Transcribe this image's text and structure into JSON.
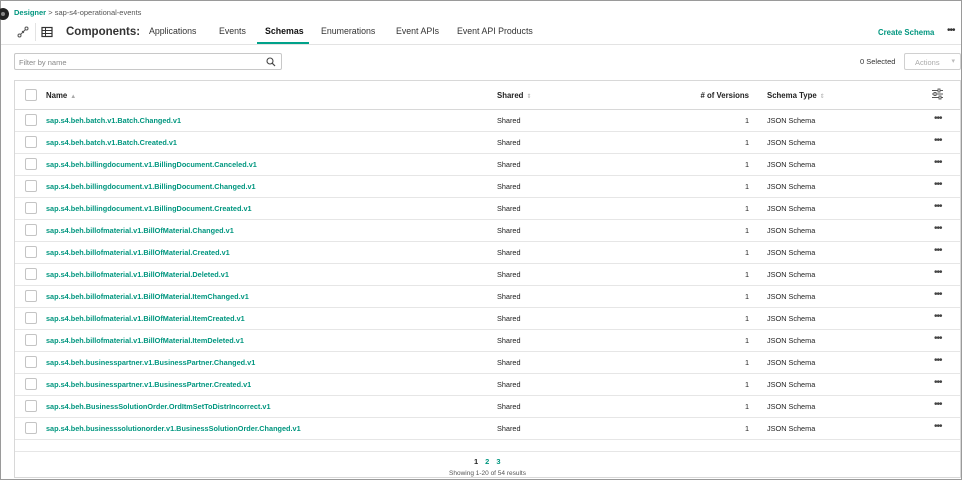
{
  "breadcrumb": {
    "root": "Designer",
    "separator": ">",
    "current": "sap-s4-operational-events"
  },
  "header": {
    "components_label": "Components:",
    "tabs": [
      {
        "label": "Applications",
        "active": false
      },
      {
        "label": "Events",
        "active": false
      },
      {
        "label": "Schemas",
        "active": true
      },
      {
        "label": "Enumerations",
        "active": false
      },
      {
        "label": "Event APIs",
        "active": false
      },
      {
        "label": "Event API Products",
        "active": false
      }
    ],
    "create_label": "Create Schema",
    "more_label": "•••"
  },
  "toolbar": {
    "filter_placeholder": "Filter by name",
    "filter_value": "",
    "selected_text": "0 Selected",
    "actions_label": "Actions"
  },
  "table": {
    "columns": {
      "name": "Name",
      "shared": "Shared",
      "versions": "# of Versions",
      "type": "Schema Type"
    },
    "rows": [
      {
        "name": "sap.s4.beh.batch.v1.Batch.Changed.v1",
        "shared": "Shared",
        "versions": "1",
        "type": "JSON Schema"
      },
      {
        "name": "sap.s4.beh.batch.v1.Batch.Created.v1",
        "shared": "Shared",
        "versions": "1",
        "type": "JSON Schema"
      },
      {
        "name": "sap.s4.beh.billingdocument.v1.BillingDocument.Canceled.v1",
        "shared": "Shared",
        "versions": "1",
        "type": "JSON Schema"
      },
      {
        "name": "sap.s4.beh.billingdocument.v1.BillingDocument.Changed.v1",
        "shared": "Shared",
        "versions": "1",
        "type": "JSON Schema"
      },
      {
        "name": "sap.s4.beh.billingdocument.v1.BillingDocument.Created.v1",
        "shared": "Shared",
        "versions": "1",
        "type": "JSON Schema"
      },
      {
        "name": "sap.s4.beh.billofmaterial.v1.BillOfMaterial.Changed.v1",
        "shared": "Shared",
        "versions": "1",
        "type": "JSON Schema"
      },
      {
        "name": "sap.s4.beh.billofmaterial.v1.BillOfMaterial.Created.v1",
        "shared": "Shared",
        "versions": "1",
        "type": "JSON Schema"
      },
      {
        "name": "sap.s4.beh.billofmaterial.v1.BillOfMaterial.Deleted.v1",
        "shared": "Shared",
        "versions": "1",
        "type": "JSON Schema"
      },
      {
        "name": "sap.s4.beh.billofmaterial.v1.BillOfMaterial.ItemChanged.v1",
        "shared": "Shared",
        "versions": "1",
        "type": "JSON Schema"
      },
      {
        "name": "sap.s4.beh.billofmaterial.v1.BillOfMaterial.ItemCreated.v1",
        "shared": "Shared",
        "versions": "1",
        "type": "JSON Schema"
      },
      {
        "name": "sap.s4.beh.billofmaterial.v1.BillOfMaterial.ItemDeleted.v1",
        "shared": "Shared",
        "versions": "1",
        "type": "JSON Schema"
      },
      {
        "name": "sap.s4.beh.businesspartner.v1.BusinessPartner.Changed.v1",
        "shared": "Shared",
        "versions": "1",
        "type": "JSON Schema"
      },
      {
        "name": "sap.s4.beh.businesspartner.v1.BusinessPartner.Created.v1",
        "shared": "Shared",
        "versions": "1",
        "type": "JSON Schema"
      },
      {
        "name": "sap.s4.beh.BusinessSolutionOrder.OrdItmSetToDistrIncorrect.v1",
        "shared": "Shared",
        "versions": "1",
        "type": "JSON Schema"
      },
      {
        "name": "sap.s4.beh.businesssolutionorder.v1.BusinessSolutionOrder.Changed.v1",
        "shared": "Shared",
        "versions": "1",
        "type": "JSON Schema"
      }
    ],
    "row_more": "•••"
  },
  "pagination": {
    "pages": [
      "1",
      "2",
      "3"
    ],
    "current_page": "1",
    "summary": "Showing 1-20 of 54 results"
  },
  "colors": {
    "accent": "#00967f",
    "tab_underline": "#00a28a"
  }
}
